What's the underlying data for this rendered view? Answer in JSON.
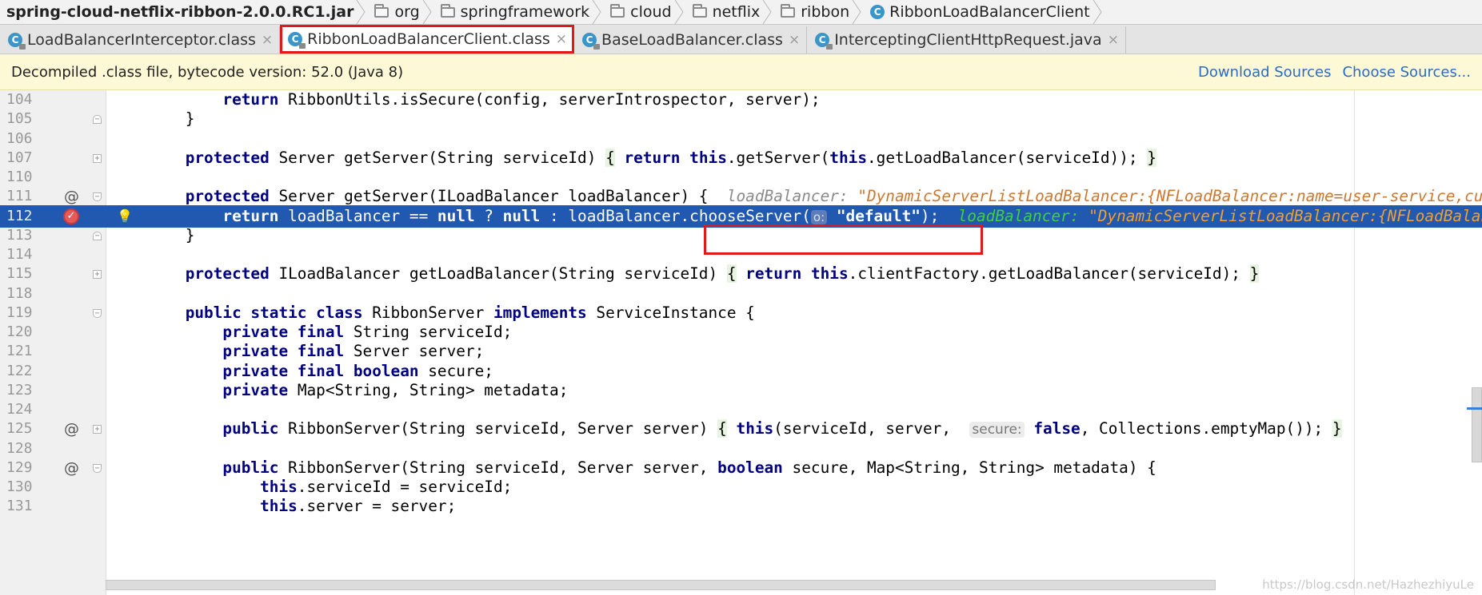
{
  "breadcrumb": [
    "spring-cloud-netflix-ribbon-2.0.0.RC1.jar",
    "org",
    "springframework",
    "cloud",
    "netflix",
    "ribbon",
    "RibbonLoadBalancerClient"
  ],
  "tabs": [
    {
      "label": "LoadBalancerInterceptor.class",
      "close": "×"
    },
    {
      "label": "RibbonLoadBalancerClient.class",
      "close": "×"
    },
    {
      "label": "BaseLoadBalancer.class",
      "close": "×"
    },
    {
      "label": "InterceptingClientHttpRequest.java",
      "close": "×"
    }
  ],
  "banner": {
    "message": "Decompiled .class file, bytecode version: 52.0 (Java 8)",
    "download_sources": "Download Sources",
    "choose_sources": "Choose Sources..."
  },
  "icons": {
    "folder": "folder-icon",
    "class": "class-icon",
    "override": "@",
    "breakpoint": "breakpoint-icon",
    "intention": "lightbulb-icon"
  },
  "editor": {
    "lines": [
      {
        "n": "104",
        "parts": [
          [
            "",
            "        "
          ],
          [
            "kw",
            "return"
          ],
          [
            "",
            " RibbonUtils.isSecure(config, serverIntrospector, server);"
          ]
        ]
      },
      {
        "n": "105",
        "parts": [
          [
            "",
            "    }"
          ]
        ]
      },
      {
        "n": "106",
        "parts": [
          [
            "",
            ""
          ]
        ]
      },
      {
        "n": "107",
        "parts": [
          [
            "",
            "    "
          ],
          [
            "kw",
            "protected"
          ],
          [
            "",
            " Server getServer(String serviceId) "
          ],
          [
            "brace",
            "{"
          ],
          [
            "",
            " "
          ],
          [
            "kw",
            "return"
          ],
          [
            "",
            " "
          ],
          [
            "kw",
            "this"
          ],
          [
            "",
            ".getServer("
          ],
          [
            "kw",
            "this"
          ],
          [
            "",
            ".getLoadBalancer(serviceId)); "
          ],
          [
            "brace",
            "}"
          ]
        ]
      },
      {
        "n": "110",
        "parts": [
          [
            "",
            ""
          ]
        ]
      },
      {
        "n": "111",
        "parts": [
          [
            "",
            "    "
          ],
          [
            "kw",
            "protected"
          ],
          [
            "",
            " Server getServer(ILoadBalancer loadBalancer) {  "
          ],
          [
            "dbg-grey",
            "loadBalancer: "
          ],
          [
            "dbg-orange",
            "\"DynamicServerListLoadBalancer:{NFLoadBalancer:name=user-service,current list of Servers=[localhost:8081],Load balancer stats=Zone stats: {}"
          ]
        ]
      },
      {
        "n": "112",
        "parts": [
          [
            "",
            "        "
          ],
          [
            "kw",
            "return"
          ],
          [
            "",
            " loadBalancer == "
          ],
          [
            "kw",
            "null"
          ],
          [
            "",
            " ? "
          ],
          [
            "kw",
            "null"
          ],
          [
            "",
            " : loadBalancer.chooseServer("
          ],
          [
            "hint",
            "o:"
          ],
          [
            "",
            " "
          ],
          [
            "str",
            "\"default\""
          ],
          [
            "",
            ");  "
          ],
          [
            "dbg-green",
            "loadBalancer: "
          ],
          [
            "dbg-yellow",
            "\"DynamicServerListLoadBalancer:{NFLoadBalancer:name=user-service,current list}\""
          ]
        ]
      },
      {
        "n": "113",
        "parts": [
          [
            "",
            "    }"
          ]
        ]
      },
      {
        "n": "114",
        "parts": [
          [
            "",
            ""
          ]
        ]
      },
      {
        "n": "115",
        "parts": [
          [
            "",
            "    "
          ],
          [
            "kw",
            "protected"
          ],
          [
            "",
            " ILoadBalancer getLoadBalancer(String serviceId) "
          ],
          [
            "brace",
            "{"
          ],
          [
            "",
            " "
          ],
          [
            "kw",
            "return"
          ],
          [
            "",
            " "
          ],
          [
            "kw",
            "this"
          ],
          [
            "",
            ".clientFactory.getLoadBalancer(serviceId); "
          ],
          [
            "brace",
            "}"
          ]
        ]
      },
      {
        "n": "118",
        "parts": [
          [
            "",
            ""
          ]
        ]
      },
      {
        "n": "119",
        "parts": [
          [
            "",
            "    "
          ],
          [
            "kw",
            "public static class"
          ],
          [
            "",
            " RibbonServer "
          ],
          [
            "kw",
            "implements"
          ],
          [
            "",
            " ServiceInstance {"
          ]
        ]
      },
      {
        "n": "120",
        "parts": [
          [
            "",
            "        "
          ],
          [
            "kw",
            "private final"
          ],
          [
            "",
            " String serviceId;"
          ]
        ]
      },
      {
        "n": "121",
        "parts": [
          [
            "",
            "        "
          ],
          [
            "kw",
            "private final"
          ],
          [
            "",
            " Server server;"
          ]
        ]
      },
      {
        "n": "122",
        "parts": [
          [
            "",
            "        "
          ],
          [
            "kw",
            "private final boolean"
          ],
          [
            "",
            " secure;"
          ]
        ]
      },
      {
        "n": "123",
        "parts": [
          [
            "",
            "        "
          ],
          [
            "kw",
            "private"
          ],
          [
            "",
            " Map<String, String> metadata;"
          ]
        ]
      },
      {
        "n": "124",
        "parts": [
          [
            "",
            ""
          ]
        ]
      },
      {
        "n": "125",
        "parts": [
          [
            "",
            "        "
          ],
          [
            "kw",
            "public"
          ],
          [
            "",
            " RibbonServer(String serviceId, Server server) "
          ],
          [
            "brace",
            "{"
          ],
          [
            "",
            " "
          ],
          [
            "kw",
            "this"
          ],
          [
            "",
            "(serviceId, server,  "
          ],
          [
            "hint",
            "secure:"
          ],
          [
            "",
            " "
          ],
          [
            "kw",
            "false"
          ],
          [
            "",
            ", Collections.emptyMap()); "
          ],
          [
            "brace",
            "}"
          ]
        ]
      },
      {
        "n": "128",
        "parts": [
          [
            "",
            ""
          ]
        ]
      },
      {
        "n": "129",
        "parts": [
          [
            "",
            "        "
          ],
          [
            "kw",
            "public"
          ],
          [
            "",
            " RibbonServer(String serviceId, Server server, "
          ],
          [
            "kw",
            "boolean"
          ],
          [
            "",
            " secure, Map<String, String> metadata) {"
          ]
        ]
      },
      {
        "n": "130",
        "parts": [
          [
            "",
            "            "
          ],
          [
            "kw",
            "this"
          ],
          [
            "",
            ".serviceId = serviceId;"
          ]
        ]
      },
      {
        "n": "131",
        "parts": [
          [
            "",
            "            "
          ],
          [
            "kw",
            "this"
          ],
          [
            "",
            ".server = server;"
          ]
        ]
      }
    ],
    "selected_line": "112",
    "override_markers": [
      "111",
      "125",
      "129"
    ],
    "fold_markers": {
      "105": "up",
      "107": "plus",
      "111": "down",
      "113": "up",
      "115": "plus",
      "119": "down",
      "125": "plus",
      "129": "down"
    }
  },
  "watermark": "https://blog.csdn.net/HazhezhiyuLe",
  "colors": {
    "selection": "#2158b0",
    "callout": "#e01a1a",
    "keyword": "#000080",
    "link": "#2a6bc4"
  }
}
